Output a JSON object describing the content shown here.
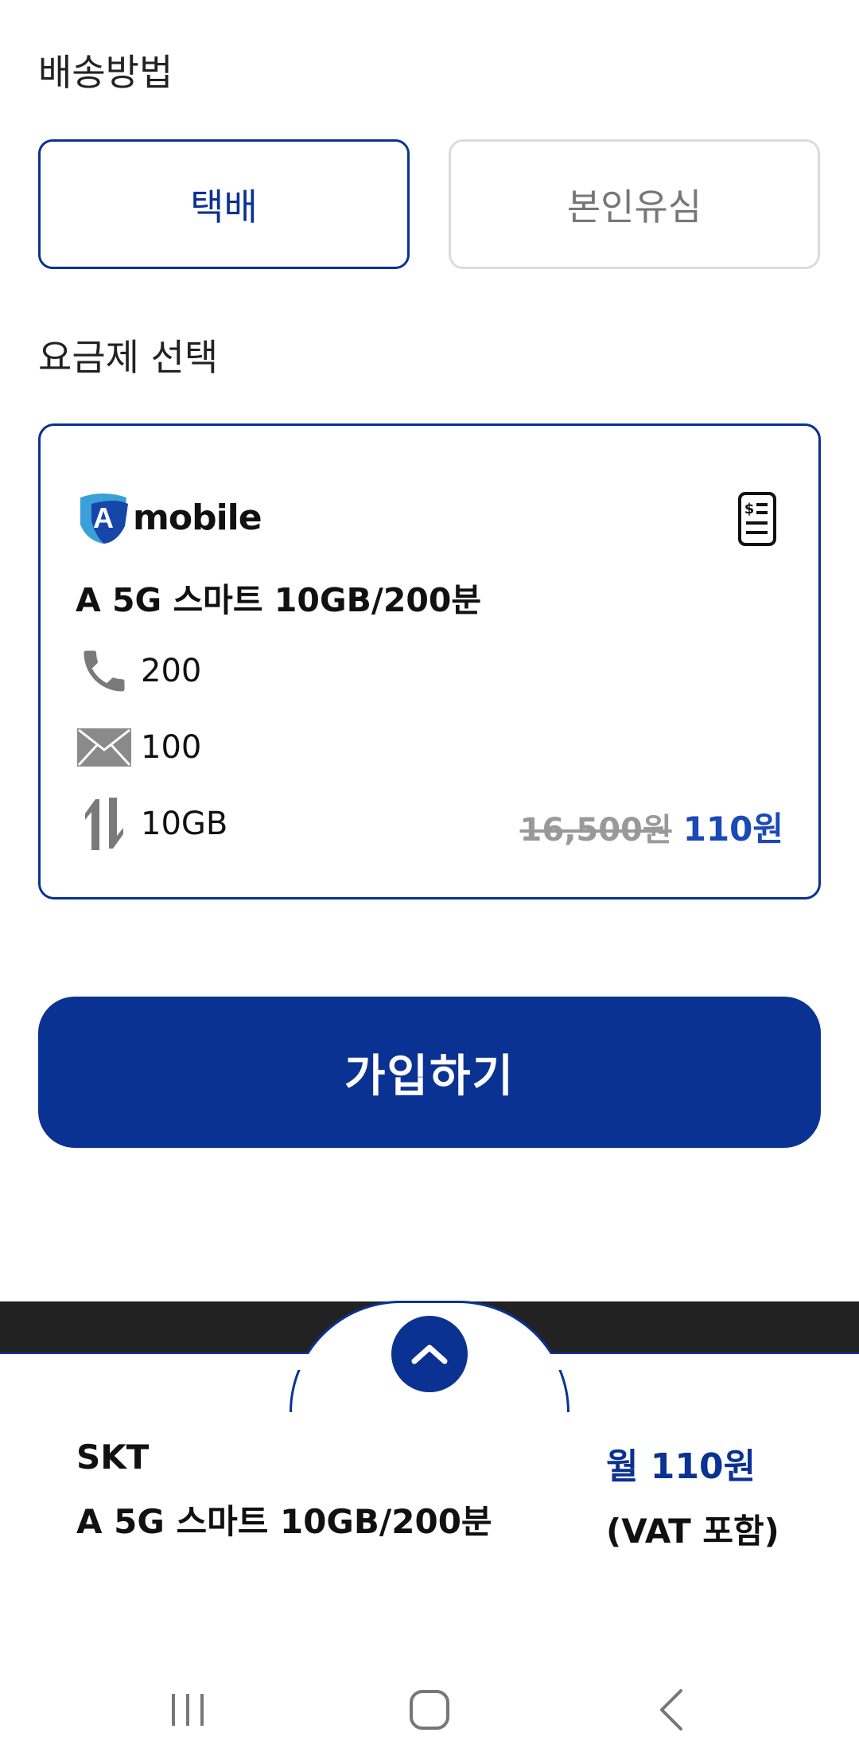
{
  "delivery": {
    "title": "배송방법",
    "options": [
      {
        "label": "택배",
        "selected": true
      },
      {
        "label": "본인유심",
        "selected": false
      }
    ]
  },
  "plan_section": {
    "title": "요금제 선택",
    "card": {
      "brand": "mobile",
      "brand_mark": "A",
      "plan_name": "A 5G 스마트 10GB/200분",
      "features": [
        {
          "icon": "phone-icon",
          "value": "200"
        },
        {
          "icon": "mail-icon",
          "value": "100"
        },
        {
          "icon": "data-transfer-icon",
          "value": "10GB"
        }
      ],
      "original_price": "16,500원",
      "sale_price": "110원"
    }
  },
  "join_button": {
    "label": "가입하기"
  },
  "summary": {
    "carrier": "SKT",
    "plan_name": "A 5G 스마트 10GB/200분",
    "monthly_price": "월 110원",
    "vat_note": "(VAT 포함)"
  },
  "colors": {
    "primary": "#0a3292",
    "sale_price": "#1a49b8",
    "strike": "#999999",
    "dark_strip": "#222222"
  }
}
